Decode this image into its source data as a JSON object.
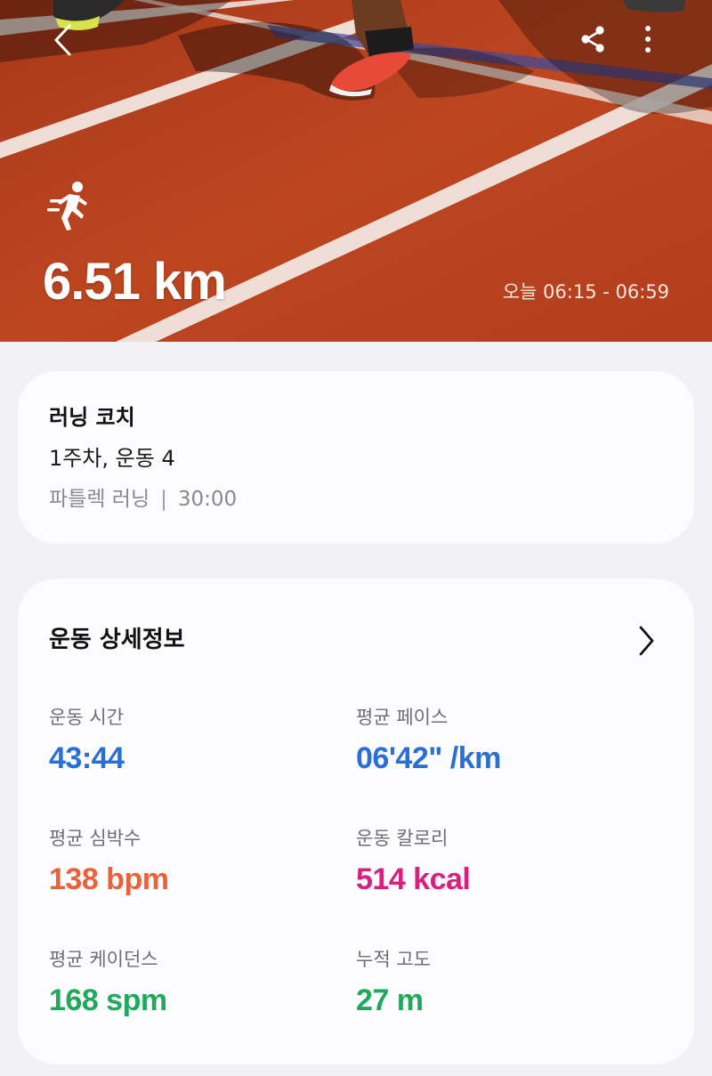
{
  "hero": {
    "distance": "6.51 km",
    "time_range": "오늘 06:15 - 06:59",
    "icons": {
      "back": "back-arrow-icon",
      "share": "share-icon",
      "more": "more-vertical-icon",
      "activity": "running-icon"
    }
  },
  "coach": {
    "title": "러닝 코치",
    "week": "1주차, 운동 4",
    "workout": "파틀렉 러닝",
    "separator": "|",
    "duration": "30:00"
  },
  "details": {
    "header": "운동 상세정보",
    "chevron_icon": "chevron-right-icon",
    "stats": [
      {
        "label": "운동 시간",
        "value": "43:44",
        "color": "#2a6fd6"
      },
      {
        "label": "평균 페이스",
        "value": "06'42\" /km",
        "color": "#2a6fd6"
      },
      {
        "label": "평균 심박수",
        "value": "138 bpm",
        "color": "#e8623a"
      },
      {
        "label": "운동 칼로리",
        "value": "514 kcal",
        "color": "#d9207e"
      },
      {
        "label": "평균 케이던스",
        "value": "168 spm",
        "color": "#1fa95c"
      },
      {
        "label": "누적 고도",
        "value": "27 m",
        "color": "#1fa95c"
      }
    ]
  }
}
